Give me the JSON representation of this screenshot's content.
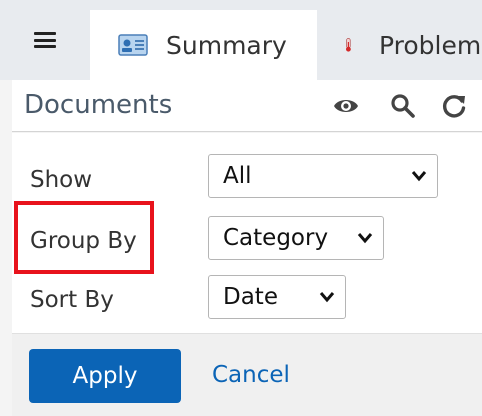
{
  "tabs": [
    {
      "label": "Summary",
      "icon": "summary-card-icon",
      "active": true
    },
    {
      "label": "Problems",
      "icon": "thermometer-icon",
      "active": false
    }
  ],
  "panel": {
    "title": "Documents",
    "icons": [
      "eye-icon",
      "search-icon",
      "refresh-icon"
    ]
  },
  "form": {
    "show": {
      "label": "Show",
      "value": "All"
    },
    "group_by": {
      "label": "Group By",
      "value": "Category"
    },
    "sort_by": {
      "label": "Sort By",
      "value": "Date"
    }
  },
  "actions": {
    "apply_label": "Apply",
    "cancel_label": "Cancel"
  },
  "colors": {
    "accent": "#0b64b6",
    "highlight": "#e8121c",
    "tab_bar": "#e8ebef"
  }
}
